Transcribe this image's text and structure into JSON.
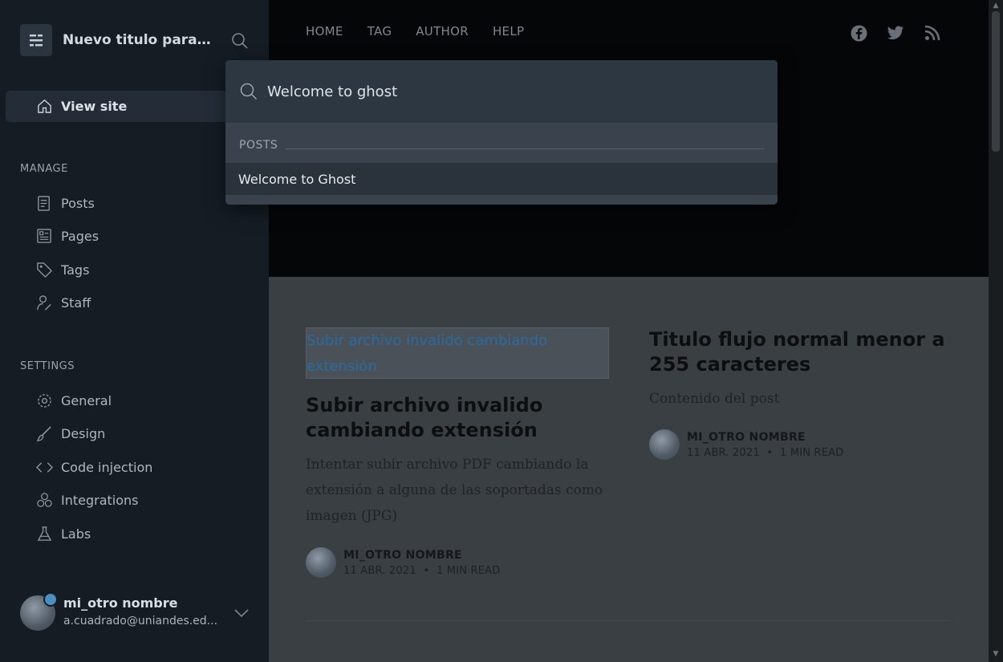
{
  "sidebar": {
    "brand_title": "Nuevo titulo para ...",
    "view_site": "View site",
    "manage_title": "MANAGE",
    "manage_items": [
      {
        "label": "Posts",
        "icon": "posts-icon"
      },
      {
        "label": "Pages",
        "icon": "pages-icon"
      },
      {
        "label": "Tags",
        "icon": "tag-icon"
      },
      {
        "label": "Staff",
        "icon": "staff-icon"
      }
    ],
    "settings_title": "SETTINGS",
    "settings_items": [
      {
        "label": "General",
        "icon": "gear-icon"
      },
      {
        "label": "Design",
        "icon": "brush-icon"
      },
      {
        "label": "Code injection",
        "icon": "code-icon"
      },
      {
        "label": "Integrations",
        "icon": "integrations-icon"
      },
      {
        "label": "Labs",
        "icon": "flask-icon"
      }
    ],
    "user": {
      "name": "mi_otro nombre",
      "email": "a.cuadrado@uniandes.ed..."
    }
  },
  "site": {
    "nav": [
      "HOME",
      "TAG",
      "AUTHOR",
      "HELP"
    ],
    "social": [
      "facebook-icon",
      "twitter-icon",
      "rss-icon"
    ]
  },
  "search": {
    "query": "Welcome to ghost",
    "section": "POSTS",
    "results": [
      "Welcome to Ghost"
    ]
  },
  "posts": [
    {
      "image_alt": "Subir archivo invalido cambiando extensión",
      "title": "Subir archivo invalido cambiando extensión",
      "excerpt": "Intentar subir archivo PDF cambiando la extensión a alguna de las soportadas como imagen (JPG)",
      "author": "MI_OTRO NOMBRE",
      "date": "11 ABR. 2021",
      "read": "1 MIN READ"
    },
    {
      "title": "Titulo flujo normal menor a 255 caracteres",
      "excerpt": "Contenido del post",
      "author": "MI_OTRO NOMBRE",
      "date": "11 ABR. 2021",
      "read": "1 MIN READ"
    }
  ],
  "colors": {
    "sidebar_bg": "#151c23",
    "hero_bg": "#050608",
    "modal_bg": "#3a434d",
    "accent": "#4c8ec4"
  }
}
